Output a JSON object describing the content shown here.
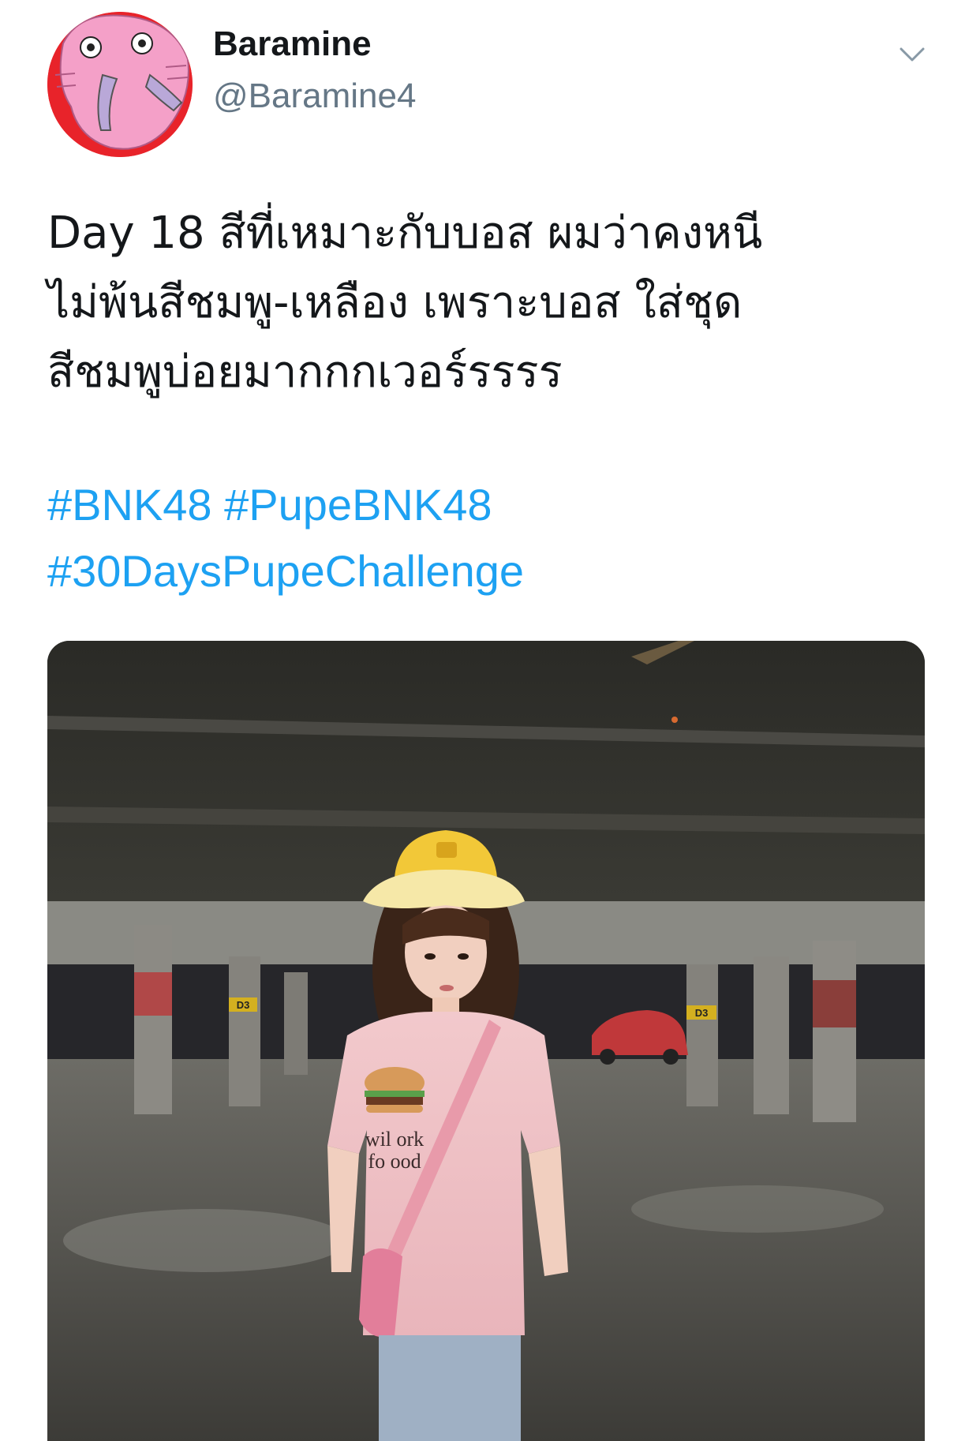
{
  "tweet": {
    "display_name": "Baramine",
    "handle": "@Baramine4",
    "text_lines": [
      "Day 18 สีที่เหมาะกับบอส ผมว่าคงหนี",
      "ไม่พ้นสีชมพู-เหลือง เพราะบอส ใส่ชุด",
      "สีชมพูบ่อยมากกกเวอร์รรรร"
    ],
    "hashtags": [
      "#BNK48",
      "#PupeBNK48",
      "#30DaysPupeChallenge"
    ]
  },
  "icons": {
    "caret": "chevron-down-icon",
    "avatar": "pink-elephant-avatar"
  },
  "photo": {
    "signs": [
      "D3",
      "D3"
    ],
    "shirt_text": [
      "wil  ork",
      "fo  ood"
    ]
  },
  "colors": {
    "hashtag": "#1da1f2",
    "handle": "#657786",
    "text": "#14171a",
    "avatar_bg": "#e8232a",
    "avatar_face": "#f4a0c8"
  }
}
